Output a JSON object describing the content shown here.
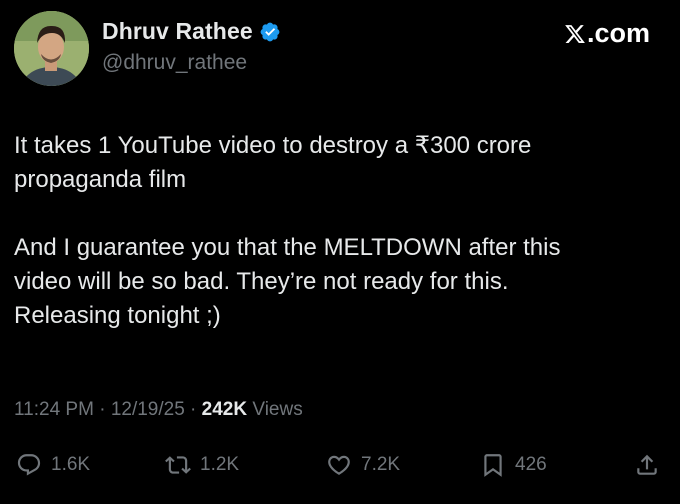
{
  "author": {
    "name": "Dhruv Rathee",
    "handle": "@dhruv_rathee",
    "verified_icon": "verified-badge-icon",
    "avatar_bg": "#8fa46c"
  },
  "brand": {
    "label": ".com",
    "icon": "x-logo-icon"
  },
  "tweet": {
    "paragraphs": [
      "It takes 1 YouTube video to destroy a ₹300 crore\npropaganda film",
      "And I guarantee you that the MELTDOWN after this\nvideo will be so bad. They’re not ready for this.\nReleasing tonight ;)"
    ]
  },
  "meta": {
    "time": "11:24 PM",
    "sep1": " · ",
    "date": "12/19/25",
    "sep2": " · ",
    "views_count": "242K",
    "views_label": " Views"
  },
  "actions": {
    "replies": "1.6K",
    "reposts": "1.2K",
    "likes": "7.2K",
    "bookmarks": "426"
  },
  "colors": {
    "background": "#000000",
    "text": "#e7e9ea",
    "muted": "#71767b",
    "verified": "#1d9bf0"
  }
}
